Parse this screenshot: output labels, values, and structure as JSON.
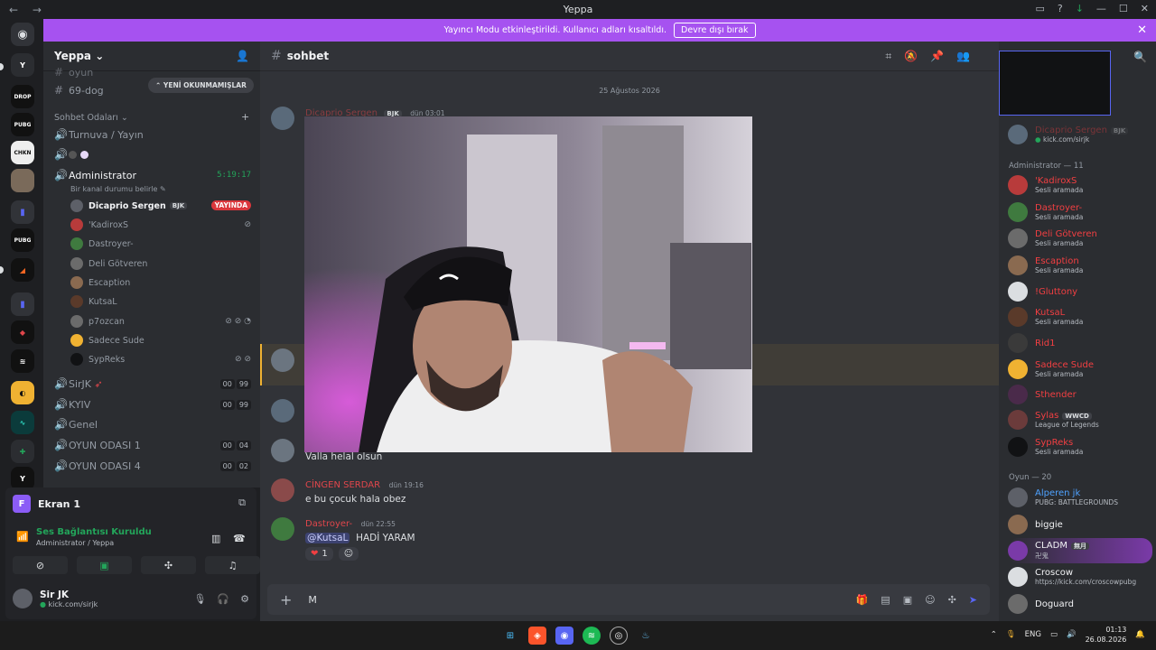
{
  "window": {
    "nav": "← →",
    "title": "Yeppa",
    "controls": [
      "▭",
      "?",
      "↓",
      "—",
      "☐",
      "✕"
    ]
  },
  "banner": {
    "text": "Yayıncı Modu etkinleştirildi. Kullanıcı adları kısaltıldı.",
    "button": "Devre dışı bırak"
  },
  "guild": {
    "name": "Yeppa"
  },
  "channels": {
    "new_unreads": "YENİ OKUNMAMIŞLAR",
    "top_channels": [
      {
        "sym": "#",
        "name": "oyun"
      },
      {
        "sym": "#",
        "name": "69-dog"
      }
    ],
    "category": "Sohbet Odaları",
    "items": [
      {
        "sym": "🔊",
        "name": "Turnuva / Yayın"
      },
      {
        "sym": "🔊",
        "name": ""
      },
      {
        "sym": "🔊",
        "name": "Administrator",
        "timer": "5:19:17",
        "status": "Bir kanal durumu belirle"
      }
    ],
    "voice_users": [
      {
        "name": "Dicaprio Sergen",
        "tag": "BJK",
        "live": "YAYINDA",
        "color": "#5d6068"
      },
      {
        "name": "'KadiroxS",
        "icons": "🎧̸",
        "color": "#b83b3b"
      },
      {
        "name": "Dastroyer-",
        "color": "#3f7a3f"
      },
      {
        "name": "Deli Götveren",
        "color": "#6b6b6b"
      },
      {
        "name": "Escaption",
        "color": "#8a6a50"
      },
      {
        "name": "KutsaL",
        "color": "#5a3a2a"
      },
      {
        "name": "p7ozcan",
        "icons": "🎙̸ 🎧̸",
        "color": "#6b6b6b"
      },
      {
        "name": "Sadece Sude",
        "color": "#f0b232"
      },
      {
        "name": "SypReks",
        "icons": "🎙̸ 🎧̸",
        "color": "#111214"
      }
    ],
    "bottom": [
      {
        "sym": "🔊",
        "name": "SirJK",
        "a": "00",
        "b": "99"
      },
      {
        "sym": "🔊",
        "name": "KYIV",
        "a": "00",
        "b": "99"
      },
      {
        "sym": "🔊",
        "name": "Genel"
      },
      {
        "sym": "🔊",
        "name": "OYUN ODASI 1",
        "a": "00",
        "b": "04"
      },
      {
        "sym": "🔊",
        "name": "OYUN ODASI 4",
        "a": "00",
        "b": "02"
      }
    ]
  },
  "user_panel": {
    "screen_letter": "F",
    "screen_label": "Ekran 1",
    "voice_status": "Ses Bağlantısı Kuruldu",
    "voice_location": "Administrator / Yeppa",
    "username": "Sir JK",
    "user_status": "kick.com/sirjk"
  },
  "chat": {
    "channel": "sohbet",
    "date": "25 Ağustos 2026",
    "messages": [
      {
        "author": "Dicaprio Sergen",
        "tag": "BJK",
        "time": "dün 03:01"
      },
      {
        "body": "Valla helal olsun"
      },
      {
        "author": "CİNGEN SERDAR",
        "time": "dün 19:16",
        "body": "e bu çocuk hala obez"
      },
      {
        "author": "Dastroyer-",
        "time": "dün 22:55",
        "mention": "@KutsaL",
        "body": "HADİ YARAM",
        "reaction_count": "1"
      }
    ],
    "composer_value": "M"
  },
  "members": {
    "top": {
      "name": "Dicaprio Sergen",
      "tag": "BJK",
      "sub": "kick.com/sirjk"
    },
    "admin_header": "Administrator — 11",
    "admin": [
      {
        "name": "'KadiroxS",
        "sub": "Sesli aramada",
        "color": "#b83b3b"
      },
      {
        "name": "Dastroyer-",
        "sub": "Sesli aramada",
        "color": "#3f7a3f"
      },
      {
        "name": "Deli Götveren",
        "sub": "Sesli aramada",
        "color": "#6b6b6b"
      },
      {
        "name": "Escaption",
        "sub": "Sesli aramada",
        "color": "#8a6a50"
      },
      {
        "name": "!Gluttony",
        "sub": "",
        "color": "#dbdee1"
      },
      {
        "name": "KutsaL",
        "sub": "Sesli aramada",
        "color": "#5a3a2a"
      },
      {
        "name": "Rid1",
        "sub": "",
        "color": "#3a3a3a"
      },
      {
        "name": "Sadece Sude",
        "sub": "Sesli aramada",
        "color": "#f0b232"
      },
      {
        "name": "Sthender",
        "sub": "",
        "color": "#4a2a4a"
      },
      {
        "name": "Sylas",
        "tag": "WWCD",
        "sub": "League of Legends",
        "color": "#6b3b3b"
      },
      {
        "name": "SypReks",
        "sub": "Sesli aramada",
        "color": "#111214"
      }
    ],
    "game_header": "Oyun — 20",
    "game": [
      {
        "name": "Alperen jk",
        "sub": "PUBG: BATTLEGROUNDS",
        "color": "#5d6068",
        "cls": "g"
      },
      {
        "name": "biggie",
        "sub": "",
        "color": "#8a6a50",
        "cls": "w"
      },
      {
        "name": "CLADM",
        "tag": "無月",
        "sub": "卍鬼",
        "color": "#7a3aa8",
        "cls": "w"
      },
      {
        "name": "Croscow",
        "sub": "https://kick.com/croscowpubg",
        "color": "#dbdee1",
        "cls": "w"
      },
      {
        "name": "Doguard",
        "sub": "",
        "color": "#6b6b6b",
        "cls": "w"
      }
    ]
  },
  "taskbar": {
    "lang": "ENG",
    "time": "01:13",
    "date": "26.08.2026"
  }
}
